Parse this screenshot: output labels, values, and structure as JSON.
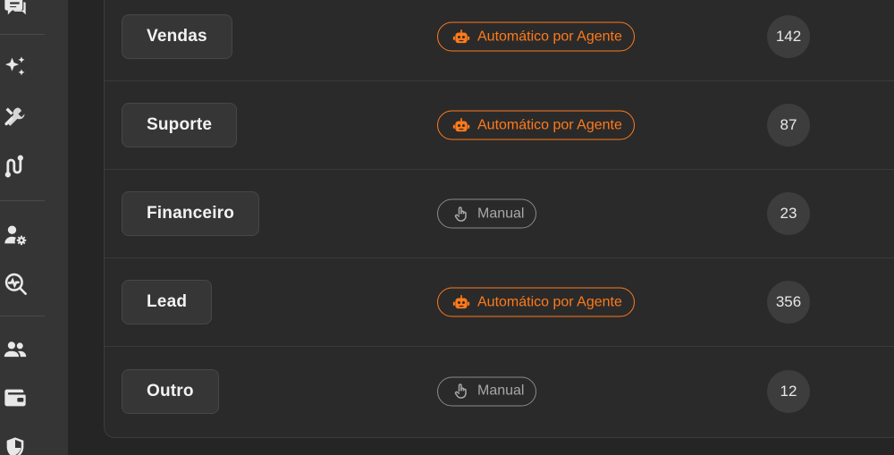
{
  "sidebar": {
    "icons": [
      {
        "name": "chat-icon"
      },
      {
        "name": "sparkles-icon"
      },
      {
        "name": "tools-icon"
      },
      {
        "name": "route-icon"
      },
      {
        "name": "user-settings-icon"
      },
      {
        "name": "analytics-search-icon"
      },
      {
        "name": "team-icon"
      },
      {
        "name": "wallet-icon"
      },
      {
        "name": "shield-icon"
      }
    ]
  },
  "modes": {
    "auto_label": "Automático por Agente",
    "manual_label": "Manual",
    "auto_color": "#ff7a1a",
    "manual_color": "#8a8a8a"
  },
  "rows": [
    {
      "name": "Vendas",
      "mode": "auto",
      "mode_label": "Automático por Agente",
      "count": "142"
    },
    {
      "name": "Suporte",
      "mode": "auto",
      "mode_label": "Automático por Agente",
      "count": "87"
    },
    {
      "name": "Financeiro",
      "mode": "manual",
      "mode_label": "Manual",
      "count": "23"
    },
    {
      "name": "Lead",
      "mode": "auto",
      "mode_label": "Automático por Agente",
      "count": "356"
    },
    {
      "name": "Outro",
      "mode": "manual",
      "mode_label": "Manual",
      "count": "12"
    }
  ]
}
